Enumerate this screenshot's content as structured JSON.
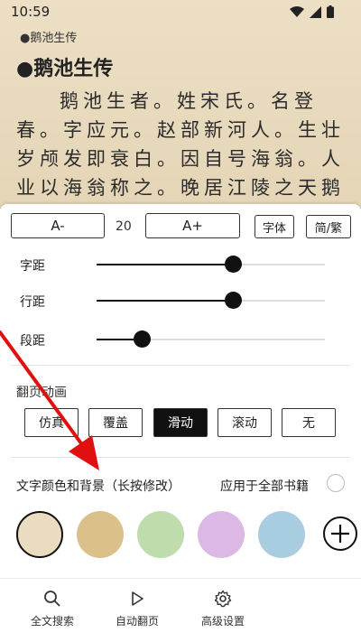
{
  "status_bar": {
    "time": "10:59"
  },
  "reader": {
    "chapter_small": "●鹅池生传",
    "chapter_title": "●鹅池生传",
    "body": "鹅池生者。姓宋氏。名登春。字应元。赵部新河人。生壮岁颅发即衰白。因自号海翁。人业以海翁称之。晚居江陵之天鹅"
  },
  "font_row": {
    "decrease": "A-",
    "size": "20",
    "increase": "A+",
    "font": "字体",
    "convert": "简/繁"
  },
  "sliders": [
    {
      "label": "字距",
      "value": 0.6
    },
    {
      "label": "行距",
      "value": 0.6
    },
    {
      "label": "段距",
      "value": 0.2
    }
  ],
  "page_anim": {
    "title": "翻页动画",
    "options": [
      "仿真",
      "覆盖",
      "滑动",
      "滚动",
      "无"
    ],
    "selected": "滑动"
  },
  "colors": {
    "title": "文字颜色和背景（长按修改）",
    "apply_all": "应用于全部书籍",
    "apply_all_checked": false,
    "swatches": [
      "#e9dcc0",
      "#dcc08c",
      "#bfdcac",
      "#dcb8e4",
      "#a8cce0"
    ],
    "selected_index": 0
  },
  "bottom_nav": [
    {
      "label": "全文搜索",
      "icon": "search-icon"
    },
    {
      "label": "自动翻页",
      "icon": "play-icon"
    },
    {
      "label": "高级设置",
      "icon": "gear-icon"
    }
  ],
  "annotation_color": "#e01010"
}
